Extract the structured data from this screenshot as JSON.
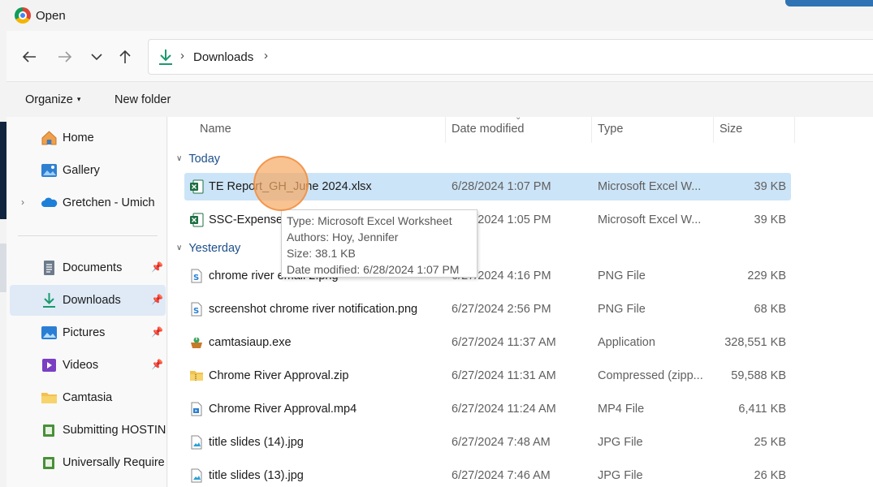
{
  "window": {
    "title": "Open"
  },
  "nav": {
    "back_icon": "←",
    "forward_icon": "→",
    "recent_icon": "⌄",
    "up_icon": "↑"
  },
  "address": {
    "breadcrumb": "Downloads",
    "chevron": "›"
  },
  "commands": {
    "organize": "Organize",
    "new_folder": "New folder",
    "organize_caret": "▾"
  },
  "sidebar": {
    "items": [
      {
        "label": "Home",
        "icon": "home-icon"
      },
      {
        "label": "Gallery",
        "icon": "gallery-icon"
      },
      {
        "label": "Gretchen - Umich",
        "icon": "onedrive-cloud-icon",
        "expander": "›"
      },
      {
        "label": "Documents",
        "icon": "documents-icon",
        "pin": "📌"
      },
      {
        "label": "Downloads",
        "icon": "download-icon",
        "pin": "📌"
      },
      {
        "label": "Pictures",
        "icon": "pictures-icon",
        "pin": "📌"
      },
      {
        "label": "Videos",
        "icon": "videos-icon",
        "pin": "📌"
      },
      {
        "label": "Camtasia",
        "icon": "folder-icon"
      },
      {
        "label": "Submitting HOSTIN",
        "icon": "spreadsheet-folder-icon"
      },
      {
        "label": "Universally Require",
        "icon": "spreadsheet-folder-icon"
      }
    ]
  },
  "columns": {
    "name": "Name",
    "date": "Date modified",
    "type": "Type",
    "size": "Size",
    "sort_indicator": "⌄"
  },
  "groups": {
    "today": "Today",
    "yesterday": "Yesterday",
    "chevron": "∨"
  },
  "files": [
    {
      "name": "TE Report_GH_June 2024.xlsx",
      "date": "6/28/2024 1:07 PM",
      "type": "Microsoft Excel W...",
      "size": "39 KB",
      "icon": "excel-icon"
    },
    {
      "name": "SSC-Expense",
      "date": "6/28/2024 1:05 PM",
      "type": "Microsoft Excel W...",
      "size": "39 KB",
      "icon": "excel-icon"
    },
    {
      "name": "chrome river email 2.png",
      "date": "6/27/2024 4:16 PM",
      "type": "PNG File",
      "size": "229 KB",
      "icon": "png-file-icon"
    },
    {
      "name": "screenshot chrome river notification.png",
      "date": "6/27/2024 2:56 PM",
      "type": "PNG File",
      "size": "68 KB",
      "icon": "png-file-icon"
    },
    {
      "name": "camtasiaup.exe",
      "date": "6/27/2024 11:37 AM",
      "type": "Application",
      "size": "328,551 KB",
      "icon": "installer-icon"
    },
    {
      "name": "Chrome River Approval.zip",
      "date": "6/27/2024 11:31 AM",
      "type": "Compressed (zipp...",
      "size": "59,588 KB",
      "icon": "zip-folder-icon"
    },
    {
      "name": "Chrome River Approval.mp4",
      "date": "6/27/2024 11:24 AM",
      "type": "MP4 File",
      "size": "6,411 KB",
      "icon": "video-file-icon"
    },
    {
      "name": "title slides (14).jpg",
      "date": "6/27/2024 7:48 AM",
      "type": "JPG File",
      "size": "25 KB",
      "icon": "image-file-icon"
    },
    {
      "name": "title slides (13).jpg",
      "date": "6/27/2024 7:46 AM",
      "type": "JPG File",
      "size": "26 KB",
      "icon": "image-file-icon"
    }
  ],
  "tooltip": {
    "type": "Type: Microsoft Excel Worksheet",
    "authors": "Authors: Hoy, Jennifer",
    "size": "Size: 38.1 KB",
    "date": "Date modified: 6/28/2024 1:07 PM"
  },
  "colors": {
    "selection": "#cce4f7",
    "nav_selected": "#dfeaf6",
    "excel_green": "#1d6f42",
    "group_blue": "#1c4f8c"
  }
}
